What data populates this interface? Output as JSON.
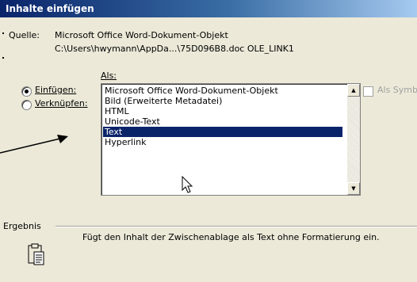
{
  "window": {
    "title": "Inhalte einfügen"
  },
  "source": {
    "label": "Quelle:",
    "line1": "Microsoft Office Word-Dokument-Objekt",
    "line2": "C:\\Users\\hwymann\\AppDa...\\75D096B8.doc OLE_LINK1"
  },
  "paste_mode": {
    "as_label": "Als:",
    "options": [
      {
        "label": "Einfügen:",
        "selected": true
      },
      {
        "label": "Verknüpfen:",
        "selected": false
      }
    ]
  },
  "format_list": {
    "items": [
      "Microsoft Office Word-Dokument-Objekt",
      "Bild (Erweiterte Metadatei)",
      "HTML",
      "Unicode-Text",
      "Text",
      "Hyperlink"
    ],
    "selected": "Text"
  },
  "display_as_icon": {
    "label": "Als Symb",
    "checked": false
  },
  "result": {
    "label": "Ergebnis",
    "description": "Fügt den Inhalt der Zwischenablage als Text ohne Formatierung ein."
  },
  "colors": {
    "title_bar": "#0a246a",
    "dialog_bg": "#ece9d8",
    "selection": "#0a246a"
  }
}
